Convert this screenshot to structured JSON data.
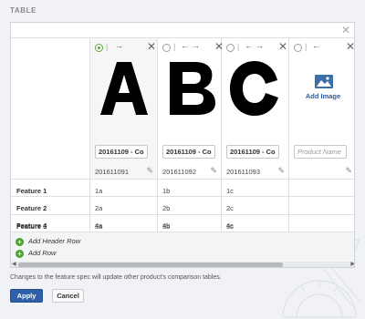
{
  "section": {
    "title": "TABLE"
  },
  "panel": {
    "close_icon": "close-icon"
  },
  "products": [
    {
      "letter": "A",
      "name_value": "20161109 - Cor",
      "name_placeholder": "",
      "sku": "201611091",
      "selected": true,
      "has_image": true
    },
    {
      "letter": "B",
      "name_value": "20161109 - Cor",
      "name_placeholder": "",
      "sku": "201611092",
      "selected": false,
      "has_image": true
    },
    {
      "letter": "C",
      "name_value": "20161109 - Cor",
      "name_placeholder": "",
      "sku": "201611093",
      "selected": false,
      "has_image": true
    },
    {
      "letter": "",
      "name_value": "",
      "name_placeholder": "Product Name",
      "sku": "",
      "selected": false,
      "has_image": false,
      "add_image_label": "Add Image"
    }
  ],
  "features": [
    {
      "label": "Feature 1",
      "values": [
        "1a",
        "1b",
        "1c",
        ""
      ]
    },
    {
      "label": "Feature 2",
      "values": [
        "2a",
        "2b",
        "2c",
        ""
      ]
    },
    {
      "label": "Feature 3",
      "values": [
        "3a",
        "3b",
        "3c",
        ""
      ]
    },
    {
      "label": "Feature 4",
      "values": [
        "4a",
        "4b",
        "4c",
        ""
      ]
    }
  ],
  "actions": {
    "add_header_row": "Add Header Row",
    "add_row": "Add Row"
  },
  "notice": "Changes to the feature spec will update other product's comparison tables.",
  "buttons": {
    "apply": "Apply",
    "cancel": "Cancel"
  },
  "colors": {
    "accent": "#2f5fa6",
    "add_green": "#4aa02c",
    "link": "#2f5d9a"
  }
}
